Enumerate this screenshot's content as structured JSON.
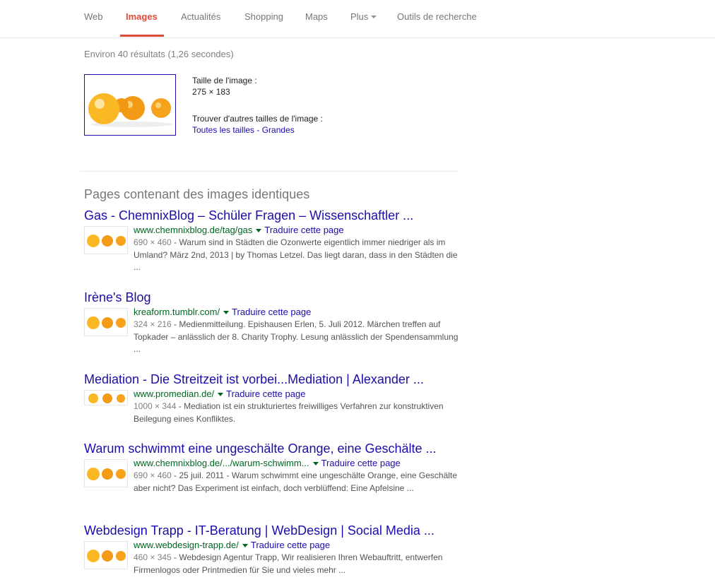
{
  "tabs": [
    {
      "label": "Web"
    },
    {
      "label": "Images"
    },
    {
      "label": "Actualités"
    },
    {
      "label": "Shopping"
    },
    {
      "label": "Maps"
    },
    {
      "label": "Plus"
    },
    {
      "label": "Outils de recherche"
    }
  ],
  "stats": "Environ 40 résultats (1,26 secondes)",
  "image_info": {
    "size_label": "Taille de l'image :",
    "size_value": "275 × 183",
    "other_sizes_label": "Trouver d'autres tailles de l'image :",
    "all_sizes_link": "Toutes les tailles",
    "separator": " - ",
    "large_link": "Grandes"
  },
  "section_title": "Pages contenant des images identiques",
  "translate_label": "Traduire cette page",
  "results": [
    {
      "title": "Gas - ChemnixBlog – Schüler Fragen – Wissenschaftler ...",
      "url": "www.chemnixblog.de/tag/gas",
      "dims": "690 × 460",
      "snippet": " - Warum sind in Städten die Ozonwerte eigentlich immer niedriger als im Umland? März 2nd, 2013 | by Thomas Letzel. Das liegt daran, dass in den Städten die ..."
    },
    {
      "title": "Irène's Blog",
      "url": "kreaform.tumblr.com/",
      "dims": "324 × 216",
      "snippet": " - Medienmitteilung. Epishausen Erlen, 5. Juli 2012. Märchen treffen auf Topkader – anlässlich der 8. Charity Trophy. Lesung anlässlich der Spendensammlung ..."
    },
    {
      "title": "Mediation - Die Streitzeit ist vorbei...Mediation | Alexander ...",
      "url": "www.promedian.de/",
      "dims": "1000 × 344",
      "snippet": " - Mediation ist ein strukturiertes freiwilliges Verfahren zur konstruktiven Beilegung eines Konfliktes."
    },
    {
      "title": "Warum schwimmt eine ungeschälte Orange, eine Geschälte ...",
      "url": "www.chemnixblog.de/.../warum-schwimm...",
      "dims": "690 × 460",
      "snippet": " - 25 juil. 2011 - Warum schwimmt eine ungeschälte Orange, eine Geschälte aber nicht? Das Experiment ist einfach, doch verblüffend: Eine Apfelsine ..."
    },
    {
      "title": "Webdesign Trapp - IT-Beratung | WebDesign | Social Media ...",
      "url": "www.webdesign-trapp.de/",
      "dims": "460 × 345",
      "snippet": " - Webdesign Agentur Trapp, Wir realisieren Ihren Webauftritt, entwerfen Firmenlogos oder Printmedien für Sie und vieles mehr ..."
    }
  ],
  "colors": {
    "accent": "#dd4b39",
    "link": "#1a0dab",
    "url": "#006621",
    "orange": "#f5a41f"
  }
}
